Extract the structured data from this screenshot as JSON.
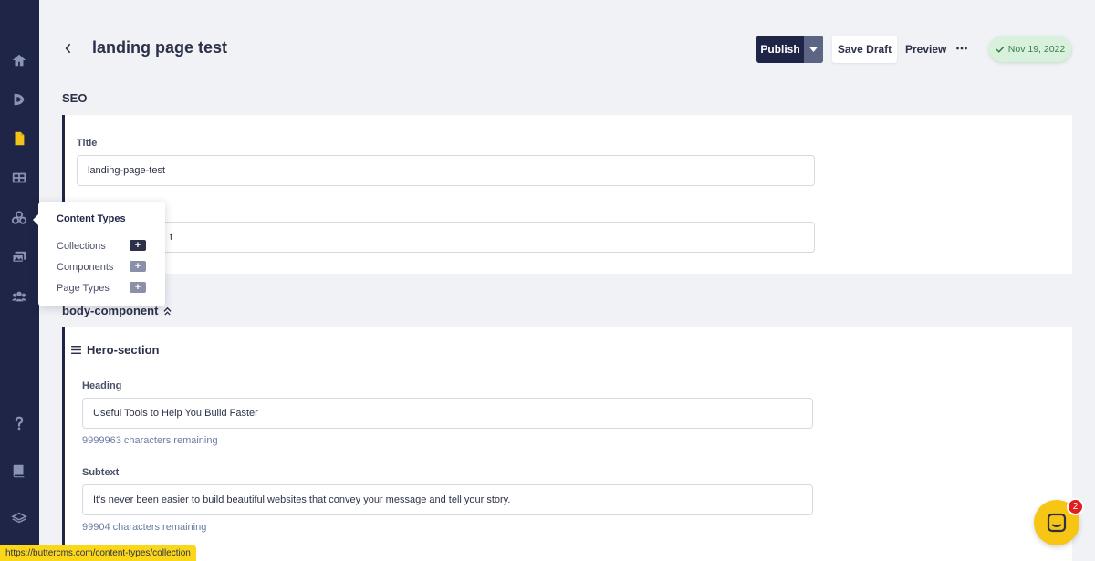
{
  "header": {
    "title": "landing page test",
    "publish_label": "Publish",
    "save_draft_label": "Save Draft",
    "preview_label": "Preview",
    "status_date": "Nov 19, 2022"
  },
  "seo": {
    "section_title": "SEO",
    "title_label": "Title",
    "title_value": "landing-page-test",
    "second_field_value_visible": "t"
  },
  "popover": {
    "title": "Content Types",
    "items": [
      {
        "label": "Collections",
        "active": true
      },
      {
        "label": "Components",
        "active": false
      },
      {
        "label": "Page Types",
        "active": false
      }
    ]
  },
  "body_component": {
    "section_title": "body-component",
    "hero_title": "Hero-section",
    "heading_label": "Heading",
    "heading_value": "Useful Tools to Help You Build Faster",
    "heading_hint": "9999963 characters remaining",
    "subtext_label": "Subtext",
    "subtext_value": "It's never been easier to build beautiful websites that convey your message and tell your story.",
    "subtext_hint": "99904 characters remaining"
  },
  "status_url": "https://buttercms.com/content-types/collection",
  "chat": {
    "badge_count": "2"
  },
  "colors": {
    "sidebar": "#1f2547",
    "accent_yellow": "#f7c614",
    "status_green_bg": "#d8f1dc",
    "status_green_text": "#3b7c4c"
  },
  "icons": [
    "home-icon",
    "blog-icon",
    "pages-icon",
    "collections-icon",
    "content-types-icon",
    "media-icon",
    "users-icon",
    "help-icon",
    "docs-icon",
    "layers-icon"
  ]
}
